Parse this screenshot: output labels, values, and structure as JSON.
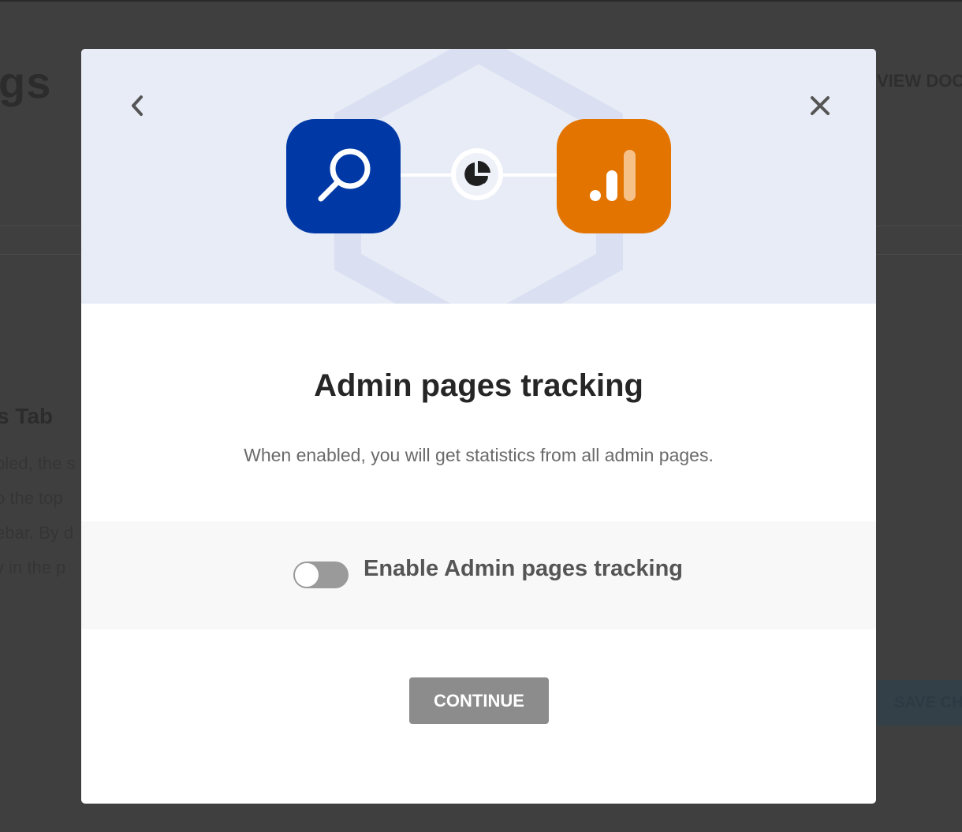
{
  "background": {
    "page_title_fragment": "gs",
    "view_docs_fragment": "VIEW DOC",
    "section_title_fragment": "s Tab",
    "paragraph_lines": [
      "bled, the s",
      "o the top",
      "ebar. By d",
      "y in the p"
    ],
    "save_fragment": "SAVE CH"
  },
  "modal": {
    "title": "Admin pages tracking",
    "description": "When enabled, you will get statistics from all admin pages.",
    "toggle": {
      "label": "Enable Admin pages tracking",
      "enabled": false
    },
    "continue_label": "CONTINUE"
  },
  "icons": {
    "back": "chevron-left-icon",
    "close": "close-icon",
    "search_app": "magnifier-icon",
    "hub": "pie-chart-icon",
    "analytics_app": "bar-chart-icon"
  },
  "colors": {
    "search_tile": "#0039a6",
    "analytics_tile": "#e37400",
    "hero_background": "#e8ecf6",
    "continue_button": "#8c8c8c",
    "overlay": "#3f3f3f"
  }
}
